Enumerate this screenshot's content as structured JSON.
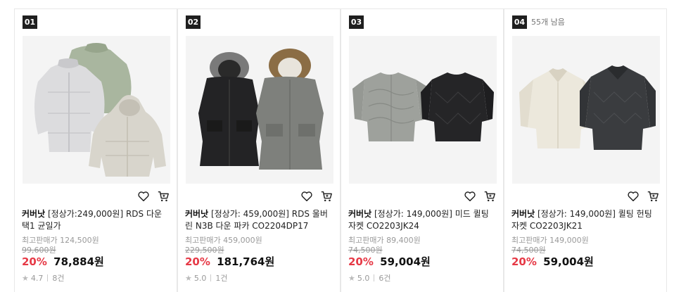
{
  "products": [
    {
      "rank": "01",
      "stock": "",
      "brand": "커버낫",
      "name": "[정상가:249,000원] RDS 다운 택1 균일가",
      "max_price": "최고판매가 124,500원",
      "orig_price": "99,600원",
      "discount": "20%",
      "sale_price": "78,884원",
      "rating": "4.7",
      "reviews": "8건"
    },
    {
      "rank": "02",
      "stock": "",
      "brand": "커버낫",
      "name": "[정상가: 459,000원] RDS 울버린 N3B 다운 파카 CO2204DP17",
      "max_price": "최고판매가 459,000원",
      "orig_price": "229,500원",
      "discount": "20%",
      "sale_price": "181,764원",
      "rating": "5.0",
      "reviews": "1건"
    },
    {
      "rank": "03",
      "stock": "",
      "brand": "커버낫",
      "name": "[정상가: 149,000원] 미드 퀼팅 자켓 CO2203JK24",
      "max_price": "최고판매가 89,400원",
      "orig_price": "74,500원",
      "discount": "20%",
      "sale_price": "59,004원",
      "rating": "5.0",
      "reviews": "6건"
    },
    {
      "rank": "04",
      "stock": "55개 남음",
      "brand": "커버낫",
      "name": "[정상가: 149,000원] 퀼팅 헌팅 자켓 CO2203JK21",
      "max_price": "최고판매가 149,000원",
      "orig_price": "74,500원",
      "discount": "20%",
      "sale_price": "59,004원",
      "rating": "",
      "reviews": ""
    }
  ],
  "icons": {
    "wishlist": "heart-outline-icon",
    "cart": "cart-icon",
    "rating": "star-icon"
  },
  "colors": {
    "discount": "#e63946",
    "rank_badge": "#1f1f1f"
  }
}
